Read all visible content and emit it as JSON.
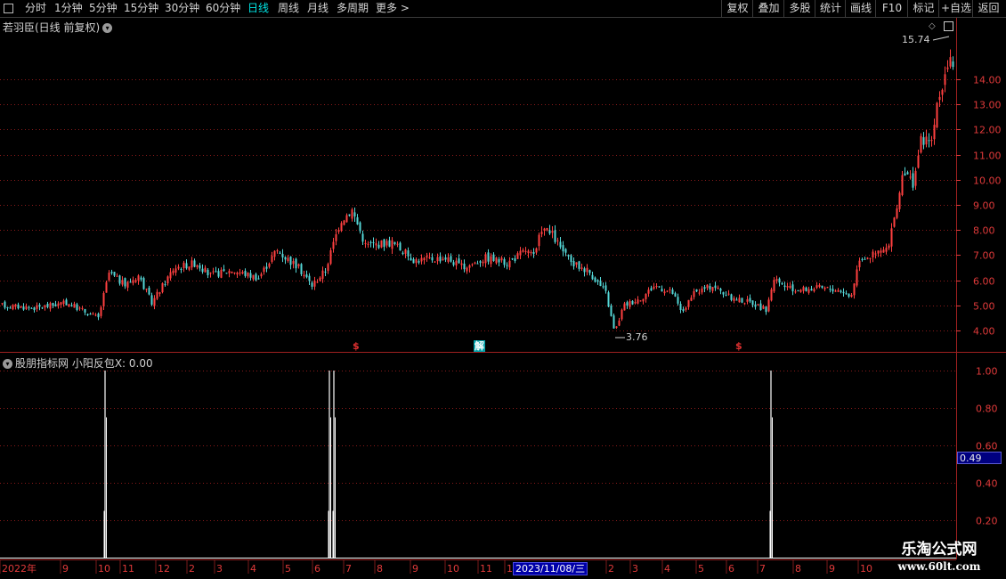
{
  "toolbar": {
    "periods": [
      "分时",
      "1分钟",
      "5分钟",
      "15分钟",
      "30分钟",
      "60分钟",
      "日线",
      "周线",
      "月线",
      "多周期",
      "更多 >"
    ],
    "active_period": "日线",
    "right_buttons": [
      "复权",
      "叠加",
      "多股",
      "统计",
      "画线",
      "F10",
      "标记",
      "+自选",
      "返回"
    ]
  },
  "main_chart": {
    "title": "若羽臣(日线 前复权)",
    "y_ticks": [
      "14.00",
      "13.00",
      "12.00",
      "11.00",
      "10.00",
      "9.00",
      "8.00",
      "7.00",
      "6.00",
      "5.00",
      "4.00"
    ],
    "high_label": "15.74",
    "low_label": "3.76",
    "markers": [
      "$",
      "解",
      "$"
    ]
  },
  "indicator": {
    "title": "股朋指标网 小阳反包X: 0.00",
    "y_ticks": [
      "1.00",
      "0.80",
      "0.60",
      "0.40",
      "0.20"
    ],
    "current_value": "0.49"
  },
  "x_axis": {
    "labels": [
      "2022年",
      "9",
      "10",
      "11",
      "12",
      "2",
      "3",
      "4",
      "5",
      "6",
      "7",
      "8",
      "9",
      "10",
      "11",
      "12",
      "2",
      "3",
      "4",
      "5",
      "6",
      "7",
      "8",
      "9",
      "10"
    ],
    "cursor_date": "2023/11/08/三"
  },
  "watermark": {
    "line1": "乐淘公式网",
    "line2": "www.60lt.com"
  },
  "colors": {
    "up": "#ff4040",
    "down": "#54d6d6",
    "grid": "#8a1a1a",
    "axis": "#e03a3a",
    "active": "#00e5e5"
  },
  "chart_data": [
    {
      "type": "candlestick",
      "title": "若羽臣(日线 前复权)",
      "ylim": [
        3.5,
        16
      ],
      "x": [
        "2022-08",
        "2022-09",
        "2022-10",
        "2022-11",
        "2022-12",
        "2023-02",
        "2023-03",
        "2023-04",
        "2023-05",
        "2023-06",
        "2023-07",
        "2023-08",
        "2023-09",
        "2023-10",
        "2023-11",
        "2023-12",
        "2024-02",
        "2024-03",
        "2024-04",
        "2024-05",
        "2024-06",
        "2024-07",
        "2024-08",
        "2024-09",
        "2024-10"
      ],
      "close": [
        5.0,
        4.7,
        5.9,
        5.5,
        6.6,
        6.4,
        6.2,
        7.1,
        6.3,
        8.6,
        7.0,
        6.7,
        6.7,
        6.6,
        7.3,
        6.0,
        3.9,
        5.5,
        4.7,
        5.6,
        5.1,
        5.5,
        5.6,
        7.0,
        13.5
      ],
      "high_label": 15.74,
      "low_label": 3.76
    },
    {
      "type": "bar",
      "title": "股朋指标网 小阳反包X: 0.00",
      "ylim": [
        0,
        1.05
      ],
      "x": [
        "2022-10",
        "2023-05",
        "2023-05",
        "2024-07"
      ],
      "values": [
        1,
        1,
        1,
        1
      ]
    }
  ]
}
